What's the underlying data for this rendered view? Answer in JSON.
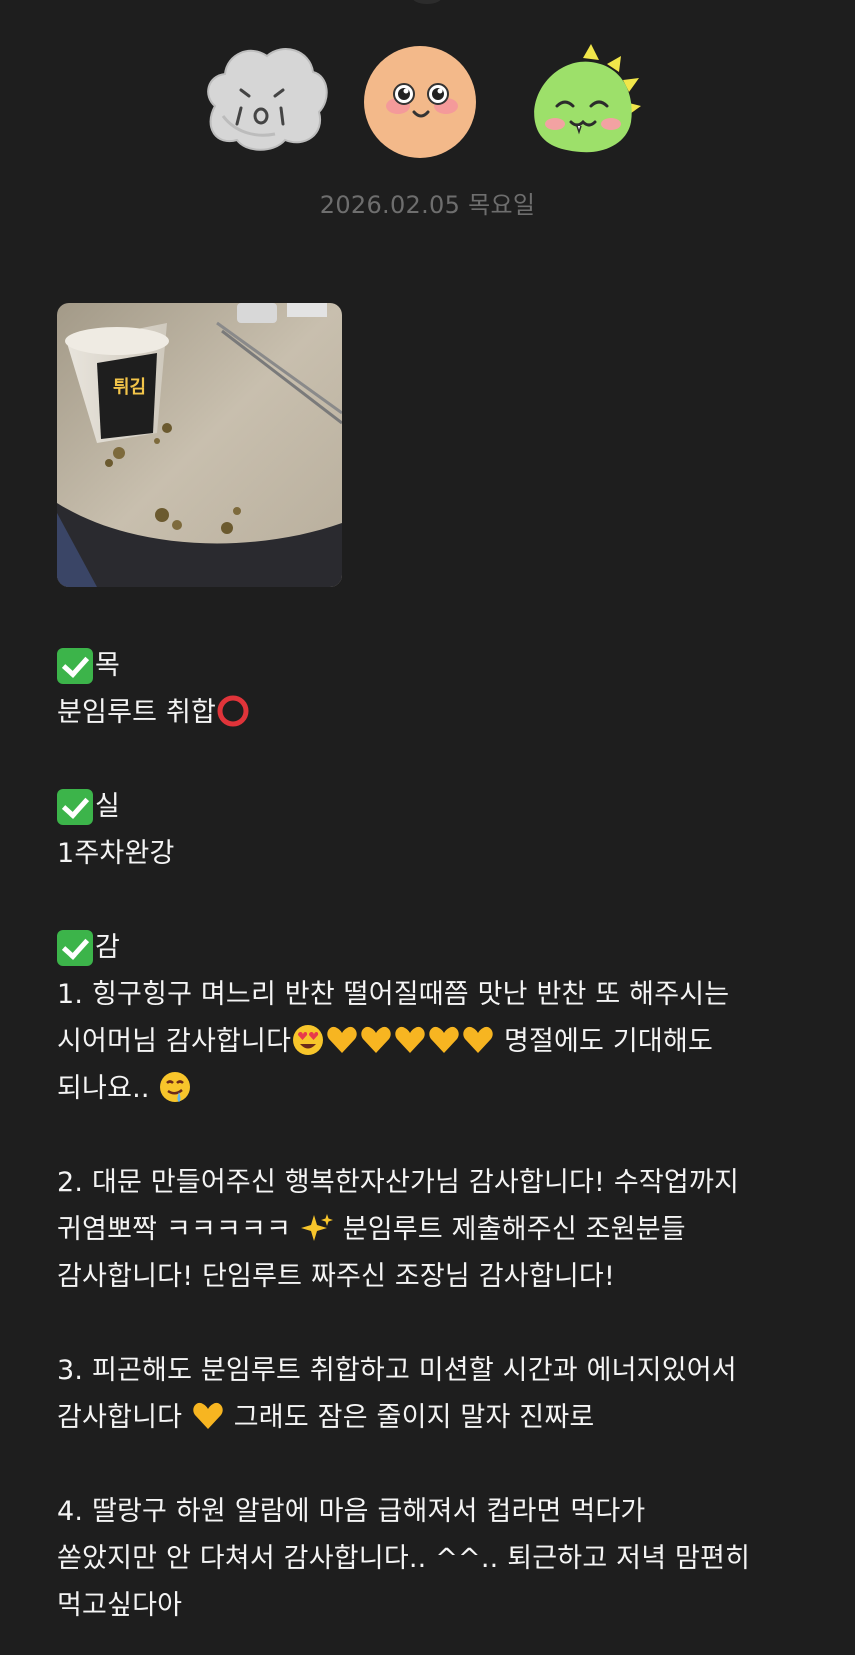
{
  "entry": {
    "date": "2026.02.05 목요일"
  },
  "avatars": [
    {
      "name": "gray-blob",
      "color": "#cfcfcf"
    },
    {
      "name": "peach-face",
      "color": "#f3b98a"
    },
    {
      "name": "green-dino",
      "color": "#9de06a"
    }
  ],
  "photo": {
    "alt_icon": "cup-ramen-photo"
  },
  "sections": {
    "mok_title": "목",
    "mok_text": "분임루트 취합",
    "sil_title": "실",
    "sil_text": "1주차완강",
    "gam_title": "감",
    "item1_line1": "1. 힝구힝구 며느리 반찬 떨어질때쯤 맛난 반찬 또 해주시는",
    "item1_line2_a": "시어머님 감사합니다",
    "item1_line2_b": " 명절에도 기대해도",
    "item1_line3": "되나요.. ",
    "item2_line1": "2. 대문 만들어주신 행복한자산가님 감사합니다! 수작업까지",
    "item2_line2_a": "귀염뽀짝 ㅋㅋㅋㅋㅋ ",
    "item2_line2_b": " 분임루트 제출해주신 조원분들",
    "item2_line3": "감사합니다! 단임루트 짜주신 조장님 감사합니다!",
    "item3_line1": "3. 피곤해도 분임루트 취합하고 미션할 시간과 에너지있어서",
    "item3_line2_a": "감사합니다 ",
    "item3_line2_b": " 그래도 잠은 줄이지 말자 진짜로",
    "item4_line1": "4. 딸랑구 하원 알람에 마음 급해져서 컵라면 먹다가",
    "item4_line2": "쏟았지만 안 다쳐서 감사합니다.. ^^.. 퇴근하고 저녁 맘편히",
    "item4_line3": "먹고싶다아"
  },
  "colors": {
    "background": "#1e1e1e",
    "date_text": "#6e6e6e",
    "check": "#3cb44a",
    "heart": "#f7b521",
    "ring": "#e0343a"
  }
}
